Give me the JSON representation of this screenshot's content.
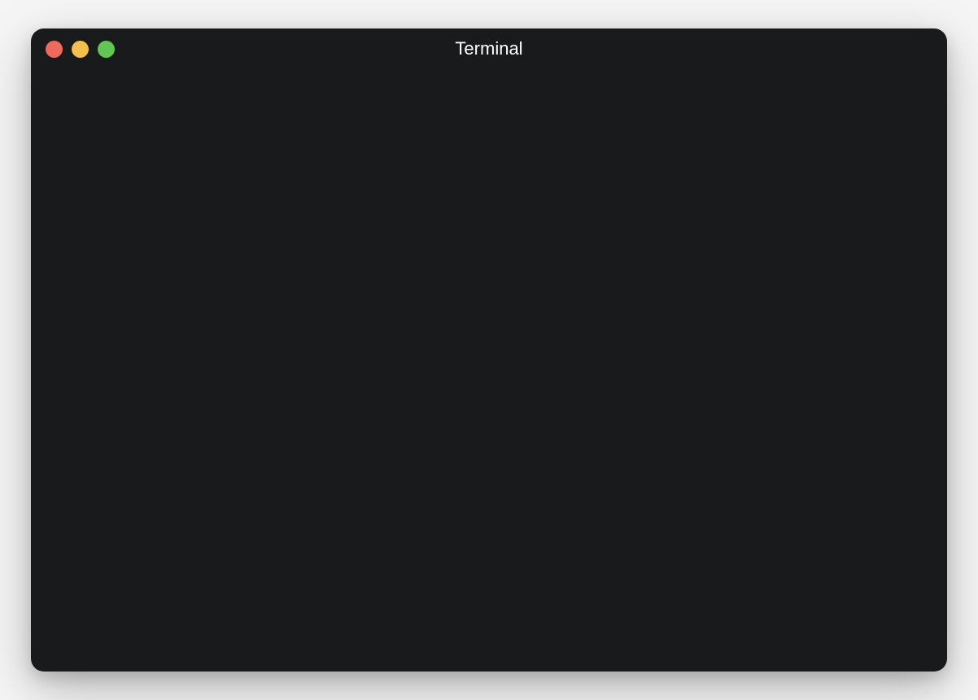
{
  "window": {
    "title": "Terminal"
  },
  "traffic_lights": {
    "close_color": "#ed6a5e",
    "minimize_color": "#f4bf4f",
    "maximize_color": "#62c554"
  },
  "terminal": {
    "content": ""
  }
}
